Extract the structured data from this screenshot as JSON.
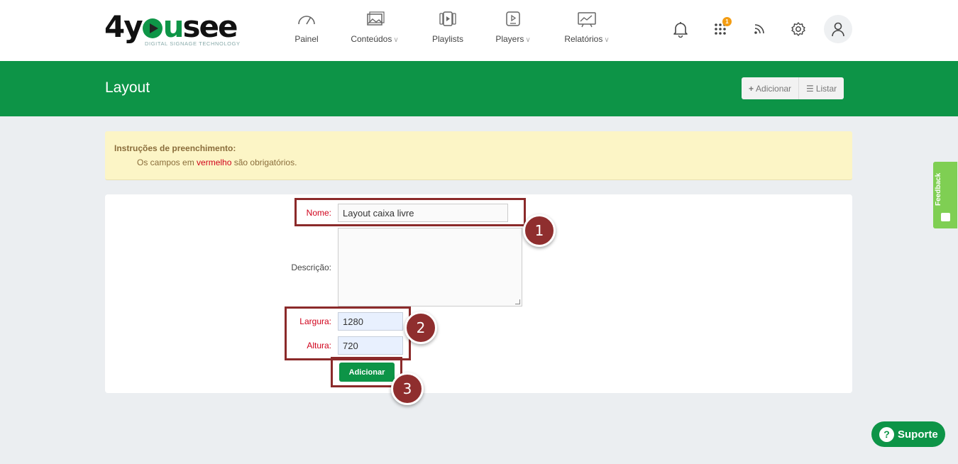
{
  "brand": {
    "logo_text_1": "4y",
    "logo_text_2": "u",
    "logo_text_3": "see",
    "tagline": "DIGITAL SIGNAGE TECHNOLOGY"
  },
  "nav": {
    "items": [
      {
        "label": "Painel",
        "icon": "gauge-icon"
      },
      {
        "label": "Conteúdos",
        "icon": "images-icon",
        "has_dropdown": true
      },
      {
        "label": "Playlists",
        "icon": "playlist-icon"
      },
      {
        "label": "Players",
        "icon": "player-icon",
        "has_dropdown": true
      },
      {
        "label": "Relatórios",
        "icon": "report-icon",
        "has_dropdown": true
      }
    ],
    "apps_badge": "1"
  },
  "header": {
    "title": "Layout",
    "add_label": "Adicionar",
    "list_label": "Listar"
  },
  "instructions": {
    "title": "Instruções de preenchimento:",
    "text_before": "Os campos em ",
    "text_red": "vermelho",
    "text_after": " são obrigatórios."
  },
  "form": {
    "nome_label": "Nome:",
    "nome_value": "Layout caixa livre",
    "descricao_label": "Descrição:",
    "descricao_value": "",
    "largura_label": "Largura:",
    "largura_value": "1280",
    "altura_label": "Altura:",
    "altura_value": "720",
    "submit_label": "Adicionar"
  },
  "annotations": [
    "1",
    "2",
    "3"
  ],
  "feedback_label": "Feedback",
  "support_label": "Suporte",
  "colors": {
    "brand_green": "#0d9447",
    "annotation_red": "#8b2a2a",
    "required_red": "#d0021b",
    "alert_bg": "#fcf5c6"
  }
}
